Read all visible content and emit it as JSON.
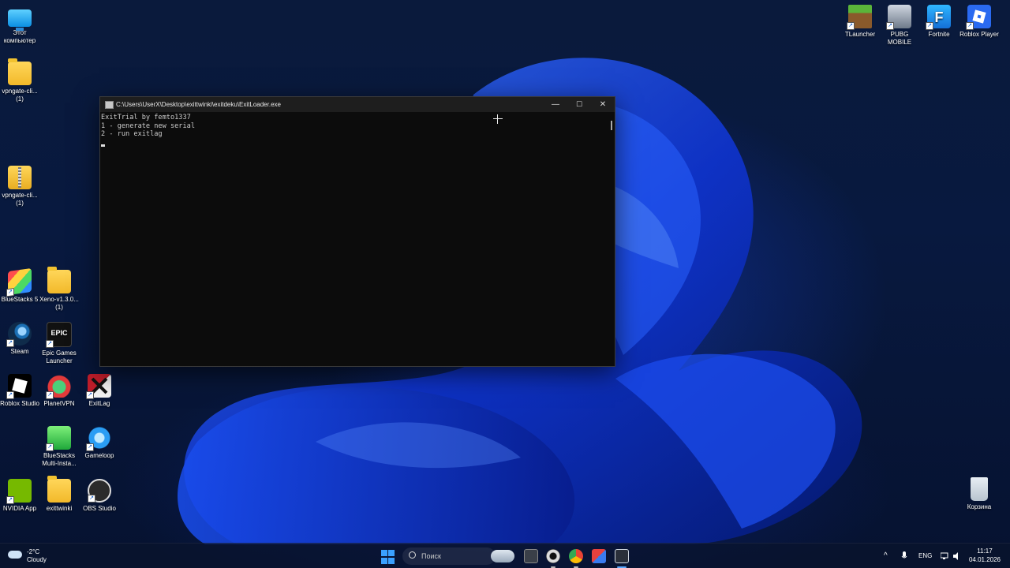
{
  "colors": {
    "accent": "#3aa0ff",
    "terminal_bg": "#0c0c0c",
    "titlebar_bg": "#1e1e1e"
  },
  "desktop_icons_left": [
    {
      "name": "this-pc-icon",
      "label": "Этот компьютер",
      "icon": "monitor-icon"
    },
    {
      "name": "vpngate-folder-icon",
      "label": "vpngate-cli... (1)",
      "icon": "folder-icon"
    },
    {
      "name": "vpngate-zip-icon",
      "label": "vpngate-cli... (1)",
      "icon": "zip-folder-icon"
    },
    {
      "name": "bluestacks5-icon",
      "label": "BlueStacks 5",
      "icon": "bluestacks-icon"
    },
    {
      "name": "xeno-folder-icon",
      "label": "Xeno-v1.3.0... (1)",
      "icon": "folder-icon"
    },
    {
      "name": "steam-icon",
      "label": "Steam",
      "icon": "steam-icon"
    },
    {
      "name": "epic-games-icon",
      "label": "Epic Games Launcher",
      "icon": "epic-icon"
    },
    {
      "name": "roblox-studio-icon",
      "label": "Roblox Studio",
      "icon": "roblox-studio-icon"
    },
    {
      "name": "planetvpn-icon",
      "label": "PlanetVPN",
      "icon": "planetvpn-icon"
    },
    {
      "name": "exitlag-icon",
      "label": "ExitLag",
      "icon": "exitlag-icon"
    },
    {
      "name": "bluestacks-multi-icon",
      "label": "BlueStacks Multi-Insta...",
      "icon": "bluestacks-multi-icon"
    },
    {
      "name": "gameloop-icon",
      "label": "Gameloop",
      "icon": "gameloop-icon"
    },
    {
      "name": "nvidia-app-icon",
      "label": "NVIDIA App",
      "icon": "nvidia-icon"
    },
    {
      "name": "exittwinki-folder-icon",
      "label": "exittwinki",
      "icon": "folder-icon"
    },
    {
      "name": "obs-studio-icon",
      "label": "OBS Studio",
      "icon": "obs-icon"
    }
  ],
  "desktop_icons_right": [
    {
      "name": "tlauncher-icon",
      "label": "TLauncher",
      "icon": "minecraft-block-icon"
    },
    {
      "name": "pubg-mobile-icon",
      "label": "PUBG MOBILE",
      "icon": "pubg-icon"
    },
    {
      "name": "fortnite-icon",
      "label": "Fortnite",
      "icon": "fortnite-icon"
    },
    {
      "name": "roblox-player-icon",
      "label": "Roblox Player",
      "icon": "roblox-icon"
    },
    {
      "name": "recycle-bin-icon",
      "label": "Корзина",
      "icon": "recycle-bin-icon"
    }
  ],
  "terminal": {
    "title": "C:\\Users\\UserX\\Desktop\\exittwinki\\exitdeku\\ExitLoader.exe",
    "lines": [
      "ExitTrial by femto1337",
      "1 - generate new serial",
      "2 - run exitlag"
    ],
    "minimize_glyph": "—",
    "maximize_glyph": "☐",
    "close_glyph": "✕"
  },
  "taskbar": {
    "weather_temp": "-2°C",
    "weather_condition": "Cloudy",
    "search_placeholder": "Поиск",
    "language": "ENG",
    "time": "11:17",
    "date": "04.01.2026",
    "tray_chevron": "^"
  }
}
